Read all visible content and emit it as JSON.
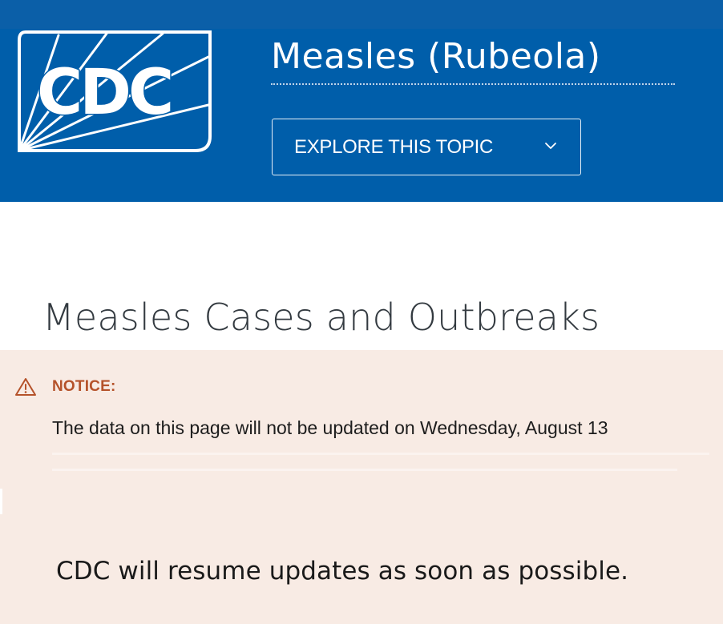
{
  "header": {
    "logo_text": "CDC",
    "site_title": "Measles (Rubeola)",
    "explore_button": "EXPLORE THIS TOPIC",
    "explore_icon": "chevron-down-icon"
  },
  "main": {
    "page_title": "Measles Cases and Outbreaks"
  },
  "notice": {
    "icon": "warning-triangle-icon",
    "label": "NOTICE:",
    "body": "The data on this page will not be updated on Wednesday, August 13",
    "resume_text": "CDC will resume updates as soon as possible."
  },
  "colors": {
    "header_blue": "#005eaa",
    "notice_background": "#f8ebe4",
    "notice_label": "#b5522a",
    "title_text": "#333a40"
  }
}
